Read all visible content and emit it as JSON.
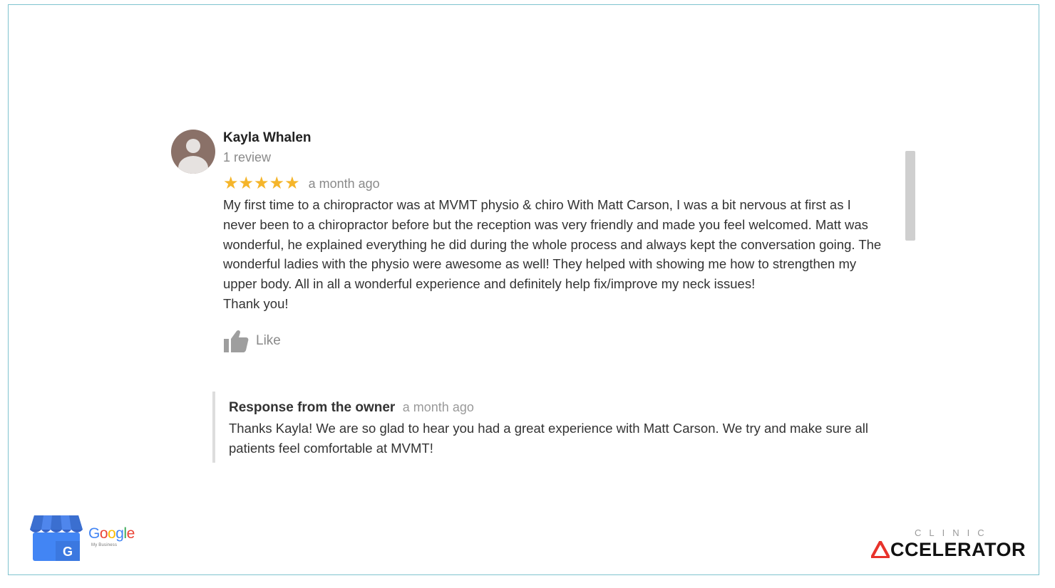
{
  "review": {
    "reviewer_name": "Kayla Whalen",
    "review_count": "1 review",
    "rating": 5,
    "stars_text": "★★★★★",
    "time": "a month ago",
    "text": "My first time to a chiropractor was at MVMT physio & chiro With Matt Carson, I was a bit nervous at first as I never been to a chiropractor before but the reception was very friendly and made you feel welcomed. Matt was wonderful, he explained everything he did during the whole process and always kept the conversation going. The wonderful ladies with the physio were awesome as well! They helped with showing me how to strengthen my upper body. All in all a wonderful experience and definitely help fix/improve my neck issues!\nThank you!",
    "like_label": "Like"
  },
  "owner_response": {
    "title": "Response from the owner",
    "time": "a month ago",
    "text": "Thanks Kayla! We are so glad to hear you had a great experience with Matt Carson. We try and make sure all patients feel comfortable at MVMT!"
  },
  "branding": {
    "google_letters": [
      "G",
      "o",
      "o",
      "g",
      "l",
      "e"
    ],
    "google_colors": [
      "#4285f4",
      "#ea4335",
      "#fbbc05",
      "#4285f4",
      "#34a853",
      "#ea4335"
    ],
    "my_business": "My Business",
    "gmb_icon_letter": "G",
    "clinic_word": "CLINIC",
    "accelerator_word": "CCELERATOR",
    "accent_red": "#e8322b"
  },
  "icons": {
    "avatar": "person-icon",
    "like": "thumbs-up-icon",
    "gmb": "google-my-business-icon",
    "accelerator_a": "triangle-a-icon"
  }
}
